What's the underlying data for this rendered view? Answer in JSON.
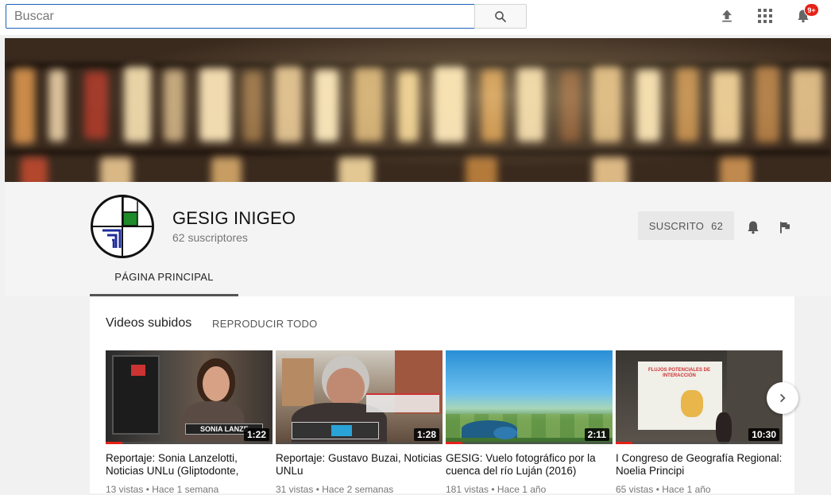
{
  "search": {
    "placeholder": "Buscar"
  },
  "topbar": {
    "notification_badge": "9+",
    "icons": [
      "upload-icon",
      "apps-grid-icon",
      "bell-icon"
    ]
  },
  "channel": {
    "name": "GESIG INIGEO",
    "subscribers": "62 suscriptores",
    "subscribe_label": "SUSCRITO",
    "subscribe_count": "62",
    "tabs": [
      {
        "label": "PÁGINA PRINCIPAL"
      }
    ]
  },
  "section": {
    "title": "Videos subidos",
    "play_all": "REPRODUCIR TODO"
  },
  "videos": [
    {
      "title": "Reportaje: Sonia Lanzelotti, Noticias UNLu (Gliptodonte,",
      "duration": "1:22",
      "meta": "13 vistas • Hace 1 semana",
      "progress": 0.1,
      "caption": "SONIA LANZE"
    },
    {
      "title": "Reportaje: Gustavo Buzai, Noticias UNLu",
      "duration": "1:28",
      "meta": "31 vistas • Hace 2 semanas",
      "progress": 0.0
    },
    {
      "title": "GESIG: Vuelo fotográfico por la cuenca del río Luján (2016)",
      "duration": "2:11",
      "meta": "181 vistas • Hace 1 año",
      "progress": 0.1
    },
    {
      "title": "I Congreso de Geografía Regional: Noelia Principi",
      "duration": "10:30",
      "meta": "65 vistas • Hace 1 año",
      "progress": 0.1,
      "slide_title": "FLUJOS POTENCIALES DE INTERACCIÓN"
    }
  ],
  "colors": {
    "accent_red": "#e62117",
    "search_border": "#1c62b9"
  }
}
